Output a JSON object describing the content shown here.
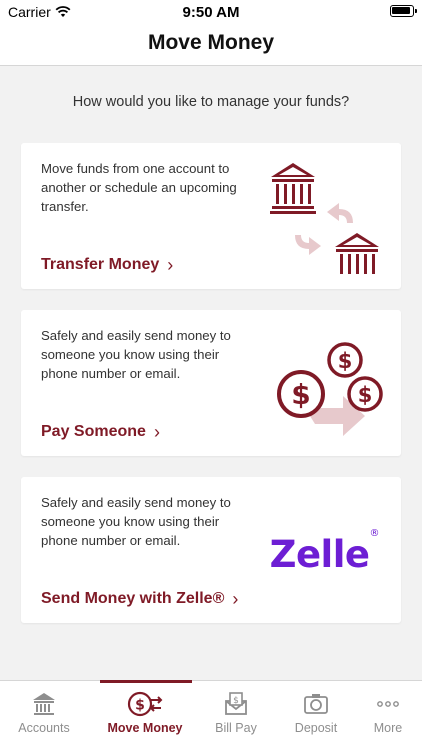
{
  "status_bar": {
    "carrier": "Carrier",
    "time": "9:50 AM"
  },
  "header": {
    "title": "Move Money"
  },
  "prompt": "How would you like to manage your funds?",
  "cards": [
    {
      "description": "Move funds from one account to another or schedule an upcoming transfer.",
      "action": "Transfer Money",
      "icon": "bank-transfer-icon"
    },
    {
      "description": "Safely and easily send money to someone you know using their phone number or email.",
      "action": "Pay Someone",
      "icon": "coins-send-icon"
    },
    {
      "description": "Safely and easily send money to someone you know using their phone number or email.",
      "action": "Send Money with Zelle®",
      "logo_text": "Zelle",
      "logo_mark": "®"
    }
  ],
  "tabs": [
    {
      "label": "Accounts",
      "icon": "bank-icon",
      "active": false
    },
    {
      "label": "Move Money",
      "icon": "dollar-transfer-icon",
      "active": true
    },
    {
      "label": "Bill Pay",
      "icon": "bill-envelope-icon",
      "active": false
    },
    {
      "label": "Deposit",
      "icon": "camera-icon",
      "active": false
    },
    {
      "label": "More",
      "icon": "more-dots-icon",
      "active": false
    }
  ],
  "colors": {
    "accent": "#7f1a26",
    "accent_light": "#e7c9cc",
    "zelle": "#6d1ed4",
    "inactive": "#8e8e8e"
  }
}
